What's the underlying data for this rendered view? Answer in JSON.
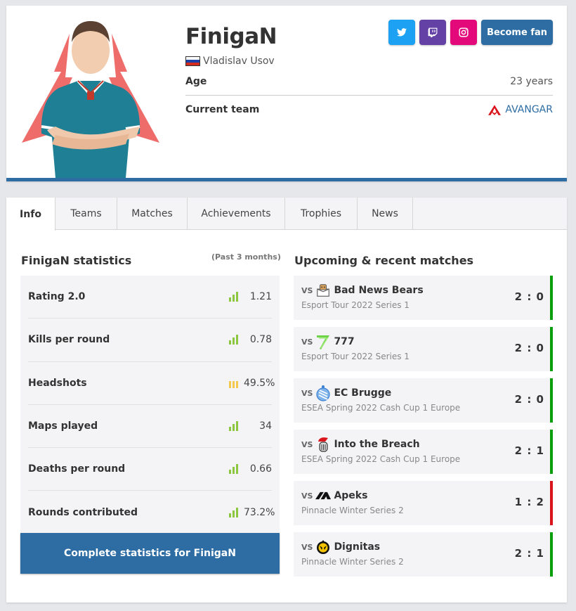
{
  "profile": {
    "nickname": "FinigaN",
    "real_name": "Vladislav Usov",
    "country_flag": "russia-flag",
    "age_label": "Age",
    "age_value": "23 years",
    "team_label": "Current team",
    "team_value": "AVANGAR",
    "team_icon": "avangar-logo-icon",
    "social": [
      {
        "name": "twitter",
        "icon": "twitter-icon",
        "color": "#1da1f2"
      },
      {
        "name": "twitch",
        "icon": "twitch-icon",
        "color": "#6441a5"
      },
      {
        "name": "instagram",
        "icon": "instagram-icon",
        "color": "#e4097a"
      }
    ],
    "fan_button": "Become fan"
  },
  "tabs": [
    {
      "label": "Info",
      "active": true
    },
    {
      "label": "Teams",
      "active": false
    },
    {
      "label": "Matches",
      "active": false
    },
    {
      "label": "Achievements",
      "active": false
    },
    {
      "label": "Trophies",
      "active": false
    },
    {
      "label": "News",
      "active": false
    }
  ],
  "stats": {
    "title": "FinigaN statistics",
    "period": "(Past 3 months)",
    "rows": [
      {
        "label": "Rating 2.0",
        "value": "1.21",
        "indicator": "good",
        "indicator_color": "#8dc63f"
      },
      {
        "label": "Kills per round",
        "value": "0.78",
        "indicator": "good",
        "indicator_color": "#8dc63f"
      },
      {
        "label": "Headshots",
        "value": "49.5%",
        "indicator": "average",
        "indicator_color": "#f2c94c"
      },
      {
        "label": "Maps played",
        "value": "34",
        "indicator": "good",
        "indicator_color": "#8dc63f"
      },
      {
        "label": "Deaths per round",
        "value": "0.66",
        "indicator": "good",
        "indicator_color": "#8dc63f"
      },
      {
        "label": "Rounds contributed",
        "value": "73.2%",
        "indicator": "good",
        "indicator_color": "#8dc63f"
      }
    ],
    "complete_button": "Complete statistics for FinigaN"
  },
  "matches": {
    "title": "Upcoming & recent matches",
    "vs_label": "VS",
    "win_color": "#0a9e0a",
    "loss_color": "#d9141b",
    "items": [
      {
        "opponent": "Bad News Bears",
        "event": "Esport Tour 2022 Series 1",
        "score": "2 : 0",
        "result": "win",
        "logo": "bad-news-bears-logo-icon"
      },
      {
        "opponent": "777",
        "event": "Esport Tour 2022 Series 1",
        "score": "2 : 0",
        "result": "win",
        "logo": "777-logo-icon"
      },
      {
        "opponent": "EC Brugge",
        "event": "ESEA Spring 2022 Cash Cup 1 Europe",
        "score": "2 : 0",
        "result": "win",
        "logo": "ec-brugge-logo-icon"
      },
      {
        "opponent": "Into the Breach",
        "event": "ESEA Spring 2022 Cash Cup 1 Europe",
        "score": "2 : 1",
        "result": "win",
        "logo": "into-the-breach-logo-icon"
      },
      {
        "opponent": "Apeks",
        "event": "Pinnacle Winter Series 2",
        "score": "1 : 2",
        "result": "loss",
        "logo": "apeks-logo-icon"
      },
      {
        "opponent": "Dignitas",
        "event": "Pinnacle Winter Series 2",
        "score": "2 : 1",
        "result": "win",
        "logo": "dignitas-logo-icon"
      }
    ]
  }
}
